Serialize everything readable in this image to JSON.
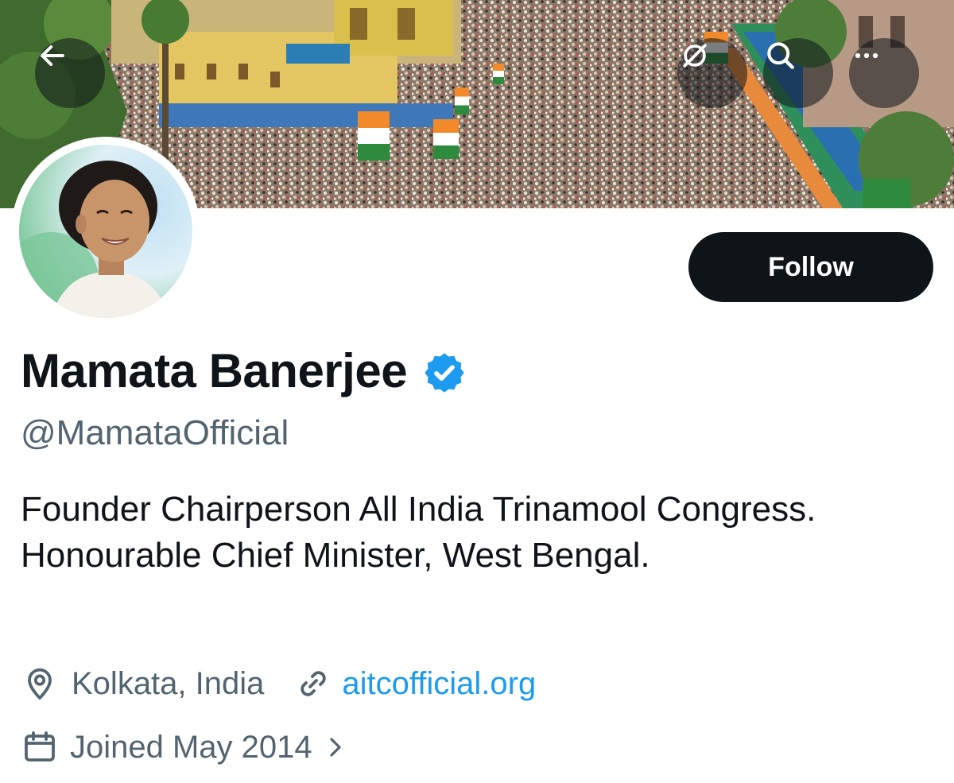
{
  "profile": {
    "display_name": "Mamata Banerjee",
    "handle": "@MamataOfficial",
    "bio": "Founder Chairperson All India Trinamool Congress. Honourable Chief Minister, West Bengal.",
    "location": "Kolkata, India",
    "website": "aitcofficial.org",
    "joined": "Joined May 2014",
    "verified": true
  },
  "actions": {
    "follow_label": "Follow"
  },
  "icons": {
    "back": "arrow-left-icon",
    "grok": "grok-icon",
    "search": "search-icon",
    "more": "more-dots-icon",
    "location": "location-pin-icon",
    "link": "link-icon",
    "calendar": "calendar-icon",
    "chevron": "chevron-right-icon",
    "verified": "verified-badge-icon"
  },
  "colors": {
    "accent": "#1d9bf0",
    "text_primary": "#0f1419",
    "text_secondary": "#536471",
    "button_dark": "#0f1419"
  }
}
